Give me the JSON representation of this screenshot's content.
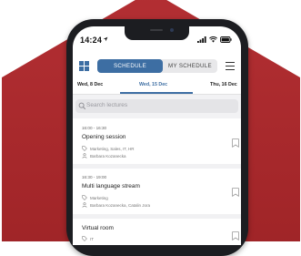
{
  "status_bar": {
    "time": "14:24"
  },
  "header": {
    "tab_schedule": "SCHEDULE",
    "tab_my_schedule": "MY SCHEDULE"
  },
  "dates": [
    {
      "label": "Wed, 8 Dec",
      "active": false
    },
    {
      "label": "Wed, 15 Dec",
      "active": true
    },
    {
      "label": "Thu, 16 Dec",
      "active": false
    }
  ],
  "search": {
    "placeholder": "Search lectures"
  },
  "sessions": [
    {
      "time": "16:00 - 16:30",
      "title": "Opening session",
      "tags": "Marketing, Sales, IT, HR",
      "speakers": "Barbara Kozanecka"
    },
    {
      "time": "16:30 - 19:00",
      "title": "Multi language stream",
      "tags": "Marketing",
      "speakers": "Barbara Kozanecka, Catalin Jora"
    },
    {
      "title": "Virtual room",
      "tags": "IT"
    }
  ],
  "colors": {
    "background_red": "#a8282c",
    "accent_blue": "#3d6ea3",
    "phone_frame": "#1c1d21"
  },
  "icons": {
    "location": "location-arrow-icon",
    "signal": "cellular-signal-icon",
    "wifi": "wifi-icon",
    "battery": "battery-icon",
    "grid": "grid-icon",
    "menu": "hamburger-menu-icon",
    "search": "search-icon",
    "tag": "tag-icon",
    "person": "person-icon",
    "bookmark": "bookmark-icon"
  }
}
